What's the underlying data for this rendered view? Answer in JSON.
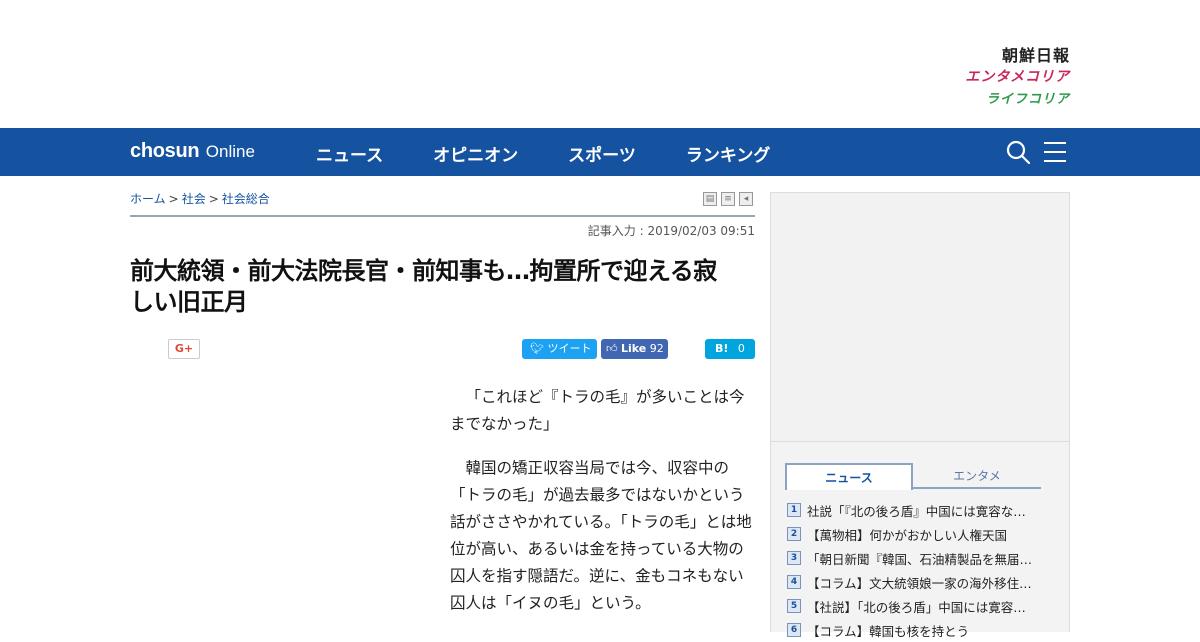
{
  "brand": {
    "main": "朝鮮日報",
    "enta": "エンタメコリア",
    "life": "ライフコリア"
  },
  "nav": {
    "logo_bold": "chosun",
    "logo_light": "Online",
    "items": [
      "ニュース",
      "オピニオン",
      "スポーツ",
      "ランキング"
    ],
    "icons": [
      "search-icon",
      "menu-icon"
    ]
  },
  "breadcrumb": [
    "ホーム",
    "社会",
    "社会総合"
  ],
  "article": {
    "date": "記事入力 : 2019/02/03 09:51",
    "headline": "前大統領・前大法院長官・前知事も…拘置所で迎える寂しい旧正月",
    "paragraphs": [
      "「これほど『トラの毛』が多いことは今までなかった」",
      "韓国の矯正収容当局では今、収容中の「トラの毛」が過去最多ではないかという話がささやかれている。「トラの毛」とは地位が高い、あるいは金を持っている大物の囚人を指す隠語だ。逆に、金もコネもない囚人は「イヌの毛」という。"
    ]
  },
  "share": {
    "gplus": "G+",
    "tweet": "ツイート",
    "like": "Like",
    "like_count": "92",
    "hatena": "B!",
    "hatena_count": "0"
  },
  "sidebar": {
    "tabs": [
      "ニュース",
      "エンタメ"
    ],
    "ranking": [
      {
        "num": "1",
        "text": "社説「『北の後ろ盾』中国には寛容な…"
      },
      {
        "num": "2",
        "text": "【萬物相】何かがおかしい人権天国"
      },
      {
        "num": "3",
        "text": "「朝日新聞『韓国、石油精製品を無届…"
      },
      {
        "num": "4",
        "text": "【コラム】文大統領娘一家の海外移住…"
      },
      {
        "num": "5",
        "text": "【社説】「北の後ろ盾」中国には寛容…"
      },
      {
        "num": "6",
        "text": "【コラム】韓国も核を持とう"
      }
    ]
  },
  "colors": {
    "nav_bg": "#1553a0",
    "enta": "#c8265d",
    "life": "#2e9a4a"
  }
}
